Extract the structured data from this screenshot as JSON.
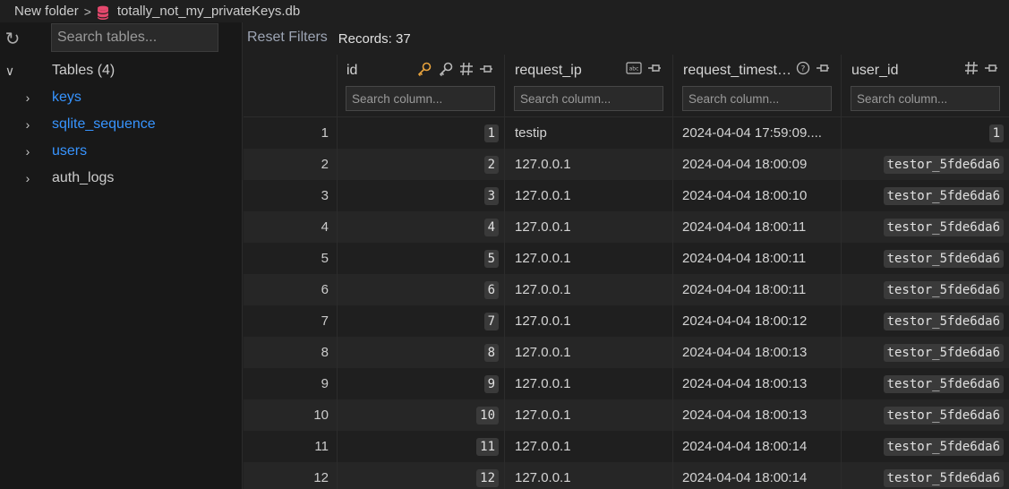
{
  "breadcrumb": {
    "folder": "New folder",
    "file": "totally_not_my_privateKeys.db"
  },
  "sidebar": {
    "search_placeholder": "Search tables...",
    "tables_header": "Tables (4)",
    "tables": [
      {
        "name": "keys"
      },
      {
        "name": "sqlite_sequence"
      },
      {
        "name": "users"
      },
      {
        "name": "auth_logs"
      }
    ]
  },
  "toolbar": {
    "reset_label": "Reset Filters",
    "records_label": "Records: 37"
  },
  "columns": [
    {
      "name": "id",
      "search_placeholder": "Search column..."
    },
    {
      "name": "request_ip",
      "search_placeholder": "Search column..."
    },
    {
      "name": "request_timest…",
      "search_placeholder": "Search column..."
    },
    {
      "name": "user_id",
      "search_placeholder": "Search column..."
    }
  ],
  "rows": [
    {
      "num": "1",
      "id": "1",
      "request_ip": "testip",
      "request_timestamp": "2024-04-04 17:59:09....",
      "user_id": "1"
    },
    {
      "num": "2",
      "id": "2",
      "request_ip": "127.0.0.1",
      "request_timestamp": "2024-04-04 18:00:09",
      "user_id": "testor_5fde6da6"
    },
    {
      "num": "3",
      "id": "3",
      "request_ip": "127.0.0.1",
      "request_timestamp": "2024-04-04 18:00:10",
      "user_id": "testor_5fde6da6"
    },
    {
      "num": "4",
      "id": "4",
      "request_ip": "127.0.0.1",
      "request_timestamp": "2024-04-04 18:00:11",
      "user_id": "testor_5fde6da6"
    },
    {
      "num": "5",
      "id": "5",
      "request_ip": "127.0.0.1",
      "request_timestamp": "2024-04-04 18:00:11",
      "user_id": "testor_5fde6da6"
    },
    {
      "num": "6",
      "id": "6",
      "request_ip": "127.0.0.1",
      "request_timestamp": "2024-04-04 18:00:11",
      "user_id": "testor_5fde6da6"
    },
    {
      "num": "7",
      "id": "7",
      "request_ip": "127.0.0.1",
      "request_timestamp": "2024-04-04 18:00:12",
      "user_id": "testor_5fde6da6"
    },
    {
      "num": "8",
      "id": "8",
      "request_ip": "127.0.0.1",
      "request_timestamp": "2024-04-04 18:00:13",
      "user_id": "testor_5fde6da6"
    },
    {
      "num": "9",
      "id": "9",
      "request_ip": "127.0.0.1",
      "request_timestamp": "2024-04-04 18:00:13",
      "user_id": "testor_5fde6da6"
    },
    {
      "num": "10",
      "id": "10",
      "request_ip": "127.0.0.1",
      "request_timestamp": "2024-04-04 18:00:13",
      "user_id": "testor_5fde6da6"
    },
    {
      "num": "11",
      "id": "11",
      "request_ip": "127.0.0.1",
      "request_timestamp": "2024-04-04 18:00:14",
      "user_id": "testor_5fde6da6"
    },
    {
      "num": "12",
      "id": "12",
      "request_ip": "127.0.0.1",
      "request_timestamp": "2024-04-04 18:00:14",
      "user_id": "testor_5fde6da6"
    }
  ],
  "colors": {
    "accent_link": "#3794ff",
    "key_icon": "#e8a33d",
    "db_icon": "#e5486d"
  }
}
